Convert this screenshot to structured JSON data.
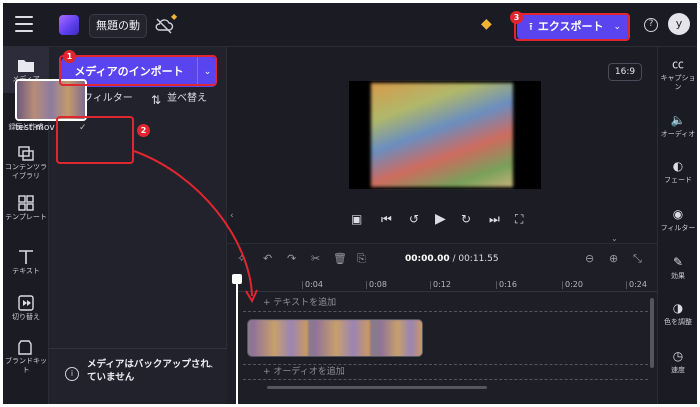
{
  "topbar": {
    "project_name": "無題の動",
    "export_label": "エクスポート",
    "avatar_initial": "y",
    "help": "?"
  },
  "leftrail": {
    "items": [
      {
        "label": "メディア",
        "icon": "folder-icon"
      },
      {
        "label": "録画と作成",
        "icon": "camera-icon"
      },
      {
        "label": "コンテンツライブラリ",
        "icon": "library-icon"
      },
      {
        "label": "テンプレート",
        "icon": "template-icon"
      },
      {
        "label": "テキスト",
        "icon": "text-icon"
      },
      {
        "label": "切り替え",
        "icon": "transition-icon"
      },
      {
        "label": "ブランドキット",
        "icon": "brand-icon"
      }
    ]
  },
  "media": {
    "import_label": "メディアのインポート",
    "filter_label": "フィルター",
    "sort_label": "並べ替え",
    "file_name": "test.mov",
    "backup_notice": "メディアはバックアップされていません"
  },
  "preview": {
    "aspect_ratio": "16:9"
  },
  "timeline": {
    "current_time": "00:00.00",
    "total_time": "00:11.55",
    "ticks": [
      "0:04",
      "0:08",
      "0:12",
      "0:16",
      "0:20",
      "0:24"
    ],
    "add_text": "+ テキストを追加",
    "add_audio": "+ オーディオを追加"
  },
  "rightrail": {
    "items": [
      {
        "label": "キャプション",
        "icon": "captions-icon"
      },
      {
        "label": "オーディオ",
        "icon": "speaker-icon"
      },
      {
        "label": "フェード",
        "icon": "fade-icon"
      },
      {
        "label": "フィルター",
        "icon": "filter-icon"
      },
      {
        "label": "効果",
        "icon": "wand-icon"
      },
      {
        "label": "色を調整",
        "icon": "contrast-icon"
      },
      {
        "label": "速度",
        "icon": "speed-icon"
      }
    ]
  },
  "annotations": {
    "step1": "1",
    "step2": "2",
    "step3": "3",
    "highlight_color": "#e0262e"
  },
  "colors": {
    "accent": "#5a44f0",
    "background": "#1f1f28"
  }
}
